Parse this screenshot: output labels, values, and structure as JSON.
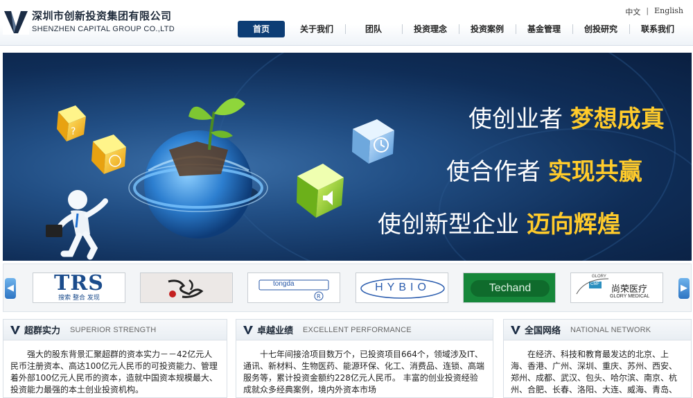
{
  "header": {
    "company_cn": "深圳市创新投资集团有限公司",
    "company_en": "SHENZHEN CAPITAL GROUP CO.,LTD",
    "lang_cn": "中文",
    "lang_sep": "|",
    "lang_en": "English"
  },
  "nav": [
    "首页",
    "关于我们",
    "团队",
    "投资理念",
    "投资案例",
    "基金管理",
    "创投研究",
    "联系我们"
  ],
  "banner": {
    "line1_prefix": "使创业者",
    "line1_highlight": "梦想成真",
    "line2_prefix": "使合作者",
    "line2_highlight": "实现共赢",
    "line3_prefix": "使创新型企业",
    "line3_highlight": "迈向辉煌"
  },
  "partners": {
    "trs_main": "TRS",
    "trs_sub": "搜索  整合  发现",
    "togda": "tongda",
    "hybio": "HYBIO",
    "techand": "Techand",
    "glory_cn": "尚荣医疗",
    "glory_en": "GLORY MEDICAL",
    "glory_arc": "GLORY",
    "glory_cmf": "CMF"
  },
  "panels": [
    {
      "title": "超群实力",
      "subtitle": "SUPERIOR STRENGTH",
      "body": "强大的股东背景汇聚超群的资本实力－－42亿元人民币注册资本、高达100亿元人民币的可投资能力、管理着外部100亿元人民币的资本，造就中国资本规模最大、投资能力最强的本土创业投资机构。"
    },
    {
      "title": "卓越业绩",
      "subtitle": "EXCELLENT PERFORMANCE",
      "body": "十七年间接洽项目数万个，已投资项目664个，领域涉及IT、通讯、新材料、生物医药、能源环保、化工、消费品、连锁、高端服务等，累计投资金额约228亿元人民币。 丰富的创业投资经验成就众多经典案例，境内外资本市场"
    },
    {
      "title": "全国网络",
      "subtitle": "NATIONAL NETWORK",
      "body": "在经济、科技和教育最发达的北京、上海、香港、广州、深圳、重庆、苏州、西安、郑州、成都、武汉、包头、哈尔滨、南京、杭州、合肥、长春、洛阳、大连、威海、青岛、"
    }
  ],
  "colors": {
    "nav_active": "#0d3d75",
    "highlight": "#ffcb2b",
    "banner_bg": "#1a3f70"
  }
}
